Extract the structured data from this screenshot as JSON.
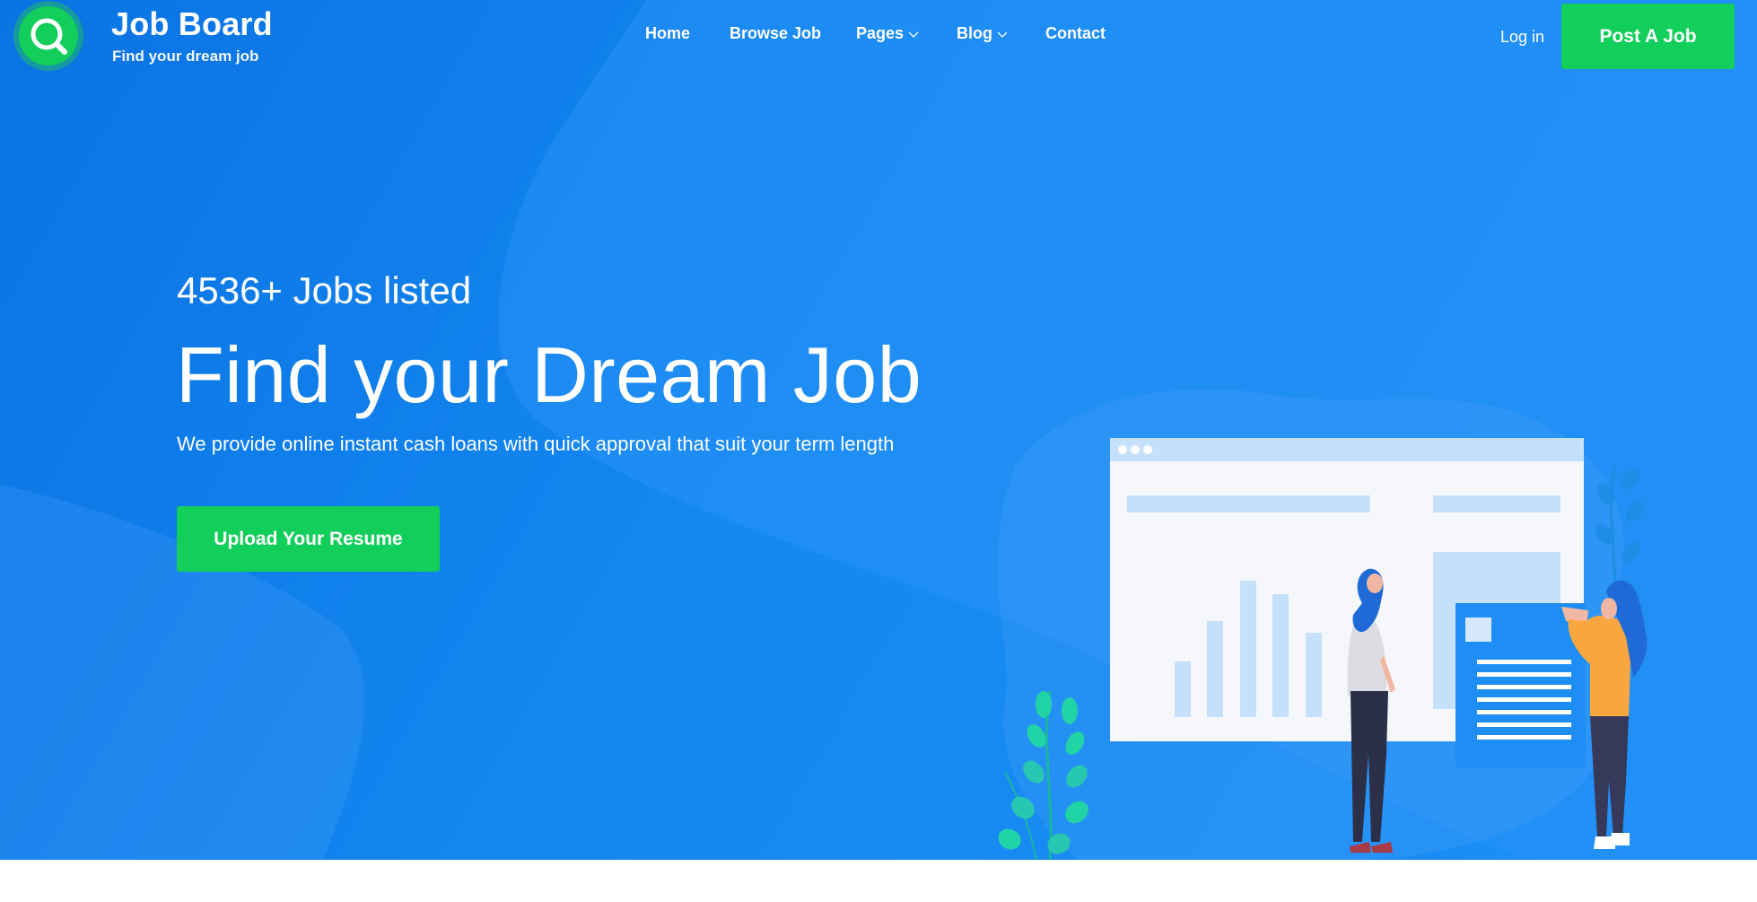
{
  "brand": {
    "name": "Job Board",
    "tagline": "Find your dream job",
    "logo_icon": "search-icon",
    "accent": "#12ce5a"
  },
  "nav": {
    "items": [
      {
        "label": "Home",
        "dropdown": false
      },
      {
        "label": "Browse Job",
        "dropdown": false
      },
      {
        "label": "Pages",
        "dropdown": true
      },
      {
        "label": "Blog",
        "dropdown": true
      },
      {
        "label": "Contact",
        "dropdown": false
      }
    ],
    "dropdown_icon": "chevron-down-icon",
    "login_label": "Log in",
    "post_job_label": "Post A Job"
  },
  "hero": {
    "count_text": "4536+ Jobs listed",
    "headline": "Find your Dream Job",
    "subtext": "We provide online instant cash loans with quick approval that suit your term length",
    "cta_label": "Upload Your Resume",
    "background": "#1487f0",
    "illustration": "dashboard-with-two-people-illustration"
  },
  "colors": {
    "hero_blue": "#0a73e3",
    "hero_blue_light": "#1b8ff7",
    "button_green": "#12ce5a",
    "text": "#ffffff"
  }
}
